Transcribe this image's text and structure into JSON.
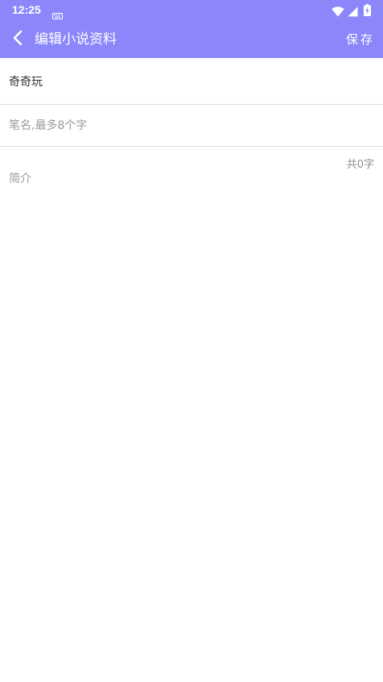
{
  "status_bar": {
    "time": "12:25",
    "icons": [
      "keyboard-icon",
      "wifi-icon",
      "signal-icon",
      "battery-charging-icon"
    ]
  },
  "app_bar": {
    "title": "编辑小说资料",
    "save_label": "保存",
    "back_icon": "chevron-left-icon",
    "background_color": "#8b87fb"
  },
  "form": {
    "novel_title_value": "奇奇玩",
    "pen_name_value": "",
    "pen_name_placeholder": "笔名,最多8个字",
    "intro_value": "",
    "intro_placeholder": "简介",
    "intro_char_count": "共0字"
  }
}
